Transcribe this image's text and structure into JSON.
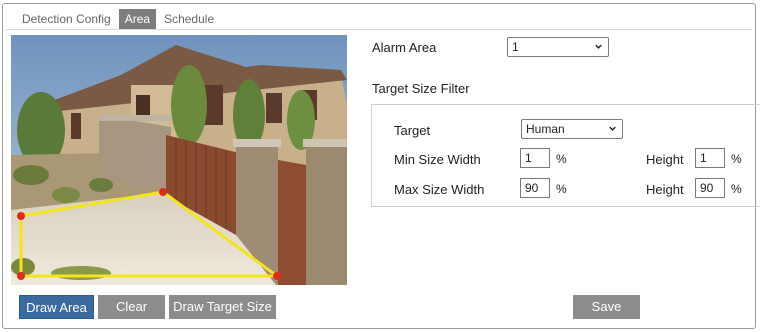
{
  "tabs": [
    {
      "label": "Detection Config"
    },
    {
      "label": "Area"
    },
    {
      "label": "Schedule"
    }
  ],
  "alarm_area": {
    "label": "Alarm Area",
    "value": "1"
  },
  "target_size_filter": {
    "title": "Target Size Filter",
    "target": {
      "label": "Target",
      "value": "Human"
    },
    "min": {
      "label": "Min Size Width",
      "width": "1",
      "height_label": "Height",
      "height": "1",
      "unit": "%"
    },
    "max": {
      "label": "Max Size Width",
      "width": "90",
      "height_label": "Height",
      "height": "90",
      "unit": "%"
    }
  },
  "buttons": {
    "draw_area": "Draw Area",
    "clear": "Clear",
    "draw_target_size": "Draw Target Size",
    "save": "Save"
  },
  "colors": {
    "active_tab": "#7d7d7d",
    "primary_button": "#3a6a9e",
    "secondary_button": "#8c8c8c",
    "area_line": "#f2e61a",
    "area_handle": "#e02a1a"
  }
}
